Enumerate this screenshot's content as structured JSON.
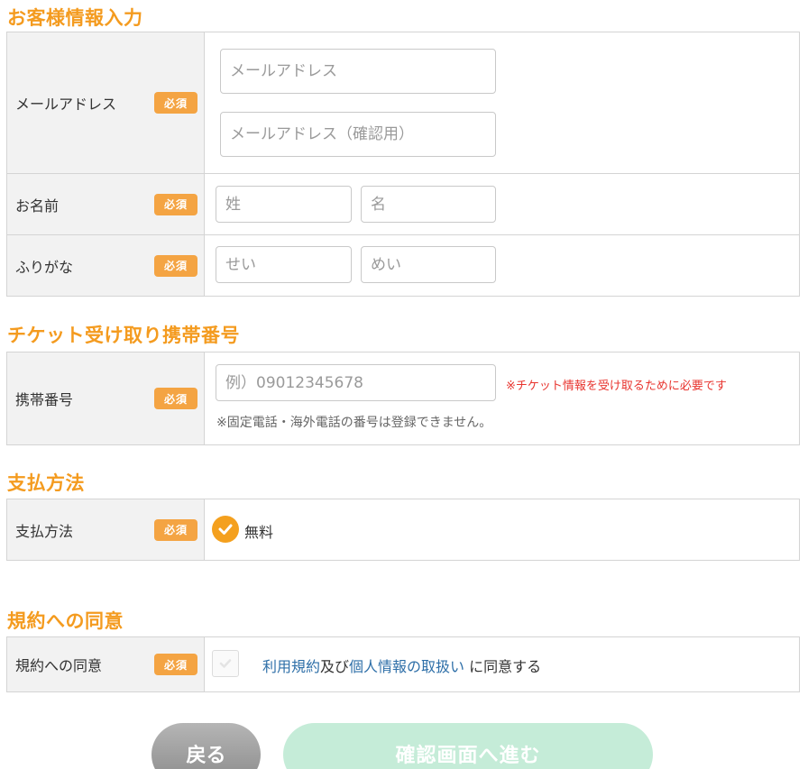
{
  "sections": {
    "customer_info": "お客様情報入力",
    "ticket_phone": "チケット受け取り携帯番号",
    "payment": "支払方法",
    "terms": "規約への同意"
  },
  "required_badge": "必須",
  "email": {
    "label": "メールアドレス",
    "placeholder": "メールアドレス",
    "confirm_placeholder": "メールアドレス（確認用）"
  },
  "name": {
    "label": "お名前",
    "last_placeholder": "姓",
    "first_placeholder": "名"
  },
  "furigana": {
    "label": "ふりがな",
    "last_placeholder": "せい",
    "first_placeholder": "めい"
  },
  "phone": {
    "label": "携帯番号",
    "placeholder": "例）09012345678",
    "required_note": "※チケット情報を受け取るために必要です",
    "restriction_note": "※固定電話・海外電話の番号は登録できません。"
  },
  "payment_method": {
    "label": "支払方法",
    "option": "無料",
    "selected": true
  },
  "agreement": {
    "label": "規約への同意",
    "terms_link": "利用規約",
    "and_text": "及び",
    "privacy_link": "個人情報の取扱い",
    "suffix": " に同意する",
    "checked": false
  },
  "buttons": {
    "back": "戻る",
    "next": "確認画面へ進む"
  },
  "colors": {
    "accent": "#f49b1f",
    "badge": "#f4a443",
    "link": "#2e6fa8",
    "error": "#e8352f"
  }
}
